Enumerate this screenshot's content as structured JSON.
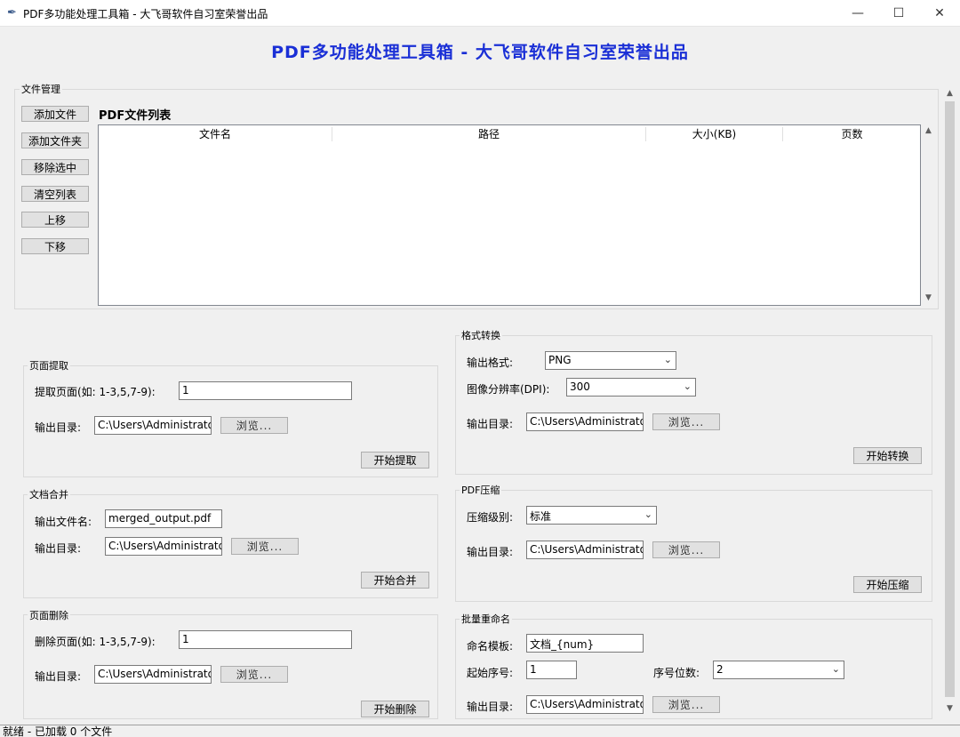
{
  "window": {
    "title": "PDF多功能处理工具箱 - 大飞哥软件自习室荣誉出品",
    "minimize": "—",
    "maximize": "☐",
    "close": "✕"
  },
  "header": {
    "title": "PDF多功能处理工具箱 - 大飞哥软件自习室荣誉出品"
  },
  "file_manage": {
    "label": "文件管理",
    "buttons": [
      "添加文件",
      "添加文件夹",
      "移除选中",
      "清空列表",
      "上移",
      "下移"
    ],
    "list_title": "PDF文件列表",
    "columns": [
      "文件名",
      "路径",
      "大小(KB)",
      "页数"
    ]
  },
  "browse_label": "浏览...",
  "extract": {
    "label": "页面提取",
    "pages_label": "提取页面(如: 1-3,5,7-9):",
    "pages_value": "1",
    "out_label": "输出目录:",
    "out_value": "C:\\Users\\Administrator\\D",
    "start": "开始提取"
  },
  "merge": {
    "label": "文档合并",
    "name_label": "输出文件名:",
    "name_value": "merged_output.pdf",
    "out_label": "输出目录:",
    "out_value": "C:\\Users\\Administrator\\D",
    "start": "开始合并"
  },
  "delete": {
    "label": "页面删除",
    "pages_label": "删除页面(如: 1-3,5,7-9):",
    "pages_value": "1",
    "out_label": "输出目录:",
    "out_value": "C:\\Users\\Administrator\\D",
    "start": "开始删除"
  },
  "convert": {
    "label": "格式转换",
    "format_label": "输出格式:",
    "format_value": "PNG",
    "dpi_label": "图像分辨率(DPI):",
    "dpi_value": "300",
    "out_label": "输出目录:",
    "out_value": "C:\\Users\\Administrator\\D",
    "start": "开始转换"
  },
  "compress": {
    "label": "PDF压缩",
    "level_label": "压缩级别:",
    "level_value": "标准",
    "out_label": "输出目录:",
    "out_value": "C:\\Users\\Administrator\\D",
    "start": "开始压缩"
  },
  "rename": {
    "label": "批量重命名",
    "template_label": "命名模板:",
    "template_value": "文档_{num}",
    "start_label": "起始序号:",
    "start_value": "1",
    "digits_label": "序号位数:",
    "digits_value": "2",
    "out_label": "输出目录:",
    "out_value": "C:\\Users\\Administrator\\D"
  },
  "status": {
    "text": "就绪 - 已加载 0 个文件"
  }
}
